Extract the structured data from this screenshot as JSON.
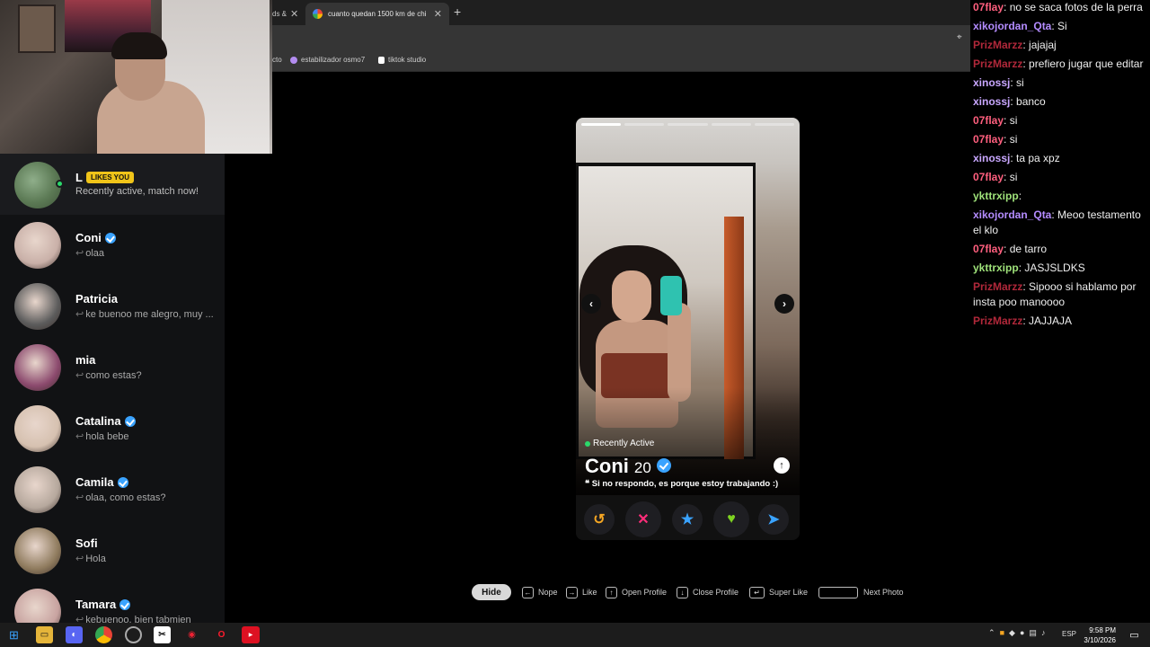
{
  "browser": {
    "tab1_fragment": "ds &",
    "tab2_title": "cuanto quedan 1500 km de chi",
    "close_glyph": "✕",
    "newtab_glyph": "+",
    "bookmarks": [
      {
        "label": "cto"
      },
      {
        "label": "estabilizador osmo7"
      },
      {
        "label": "tiktok studio"
      }
    ]
  },
  "likes": {
    "initial": "L",
    "badge": "LIKES YOU",
    "subtitle": "Recently active, match now!"
  },
  "matches": [
    {
      "name": "Coni",
      "verified": true,
      "msg": "olaa",
      "color": "#c9b0a8"
    },
    {
      "name": "Patricia",
      "verified": false,
      "msg": "ke buenoo me alegro, muy ...",
      "color": "#5c5c5c"
    },
    {
      "name": "mia",
      "verified": false,
      "msg": "como estas?",
      "color": "#8c4a6e"
    },
    {
      "name": "Catalina",
      "verified": true,
      "msg": "hola bebe",
      "color": "#d6c1b0"
    },
    {
      "name": "Camila",
      "verified": true,
      "msg": "olaa, como estas?",
      "color": "#b6a89d"
    },
    {
      "name": "Sofi",
      "verified": false,
      "msg": "Hola",
      "color": "#8f7b5e"
    },
    {
      "name": "Tamara",
      "verified": true,
      "msg": "kebuenoo, bien tabmien",
      "color": "#c8a3a0"
    }
  ],
  "profile": {
    "status": "Recently Active",
    "name": "Coni",
    "age": "20",
    "bio": "❝ Si no respondo, es porque estoy trabajando :)",
    "photo_count": 5,
    "current_photo": 0
  },
  "actions": [
    {
      "name": "rewind",
      "glyph": "↺",
      "color": "#f5a623"
    },
    {
      "name": "nope",
      "glyph": "✕",
      "color": "#ff2d7a"
    },
    {
      "name": "super-like",
      "glyph": "★",
      "color": "#3aa3ff"
    },
    {
      "name": "like",
      "glyph": "♥",
      "color": "#7ed321"
    },
    {
      "name": "boost",
      "glyph": "➤",
      "color": "#3aa3ff"
    }
  ],
  "hints": {
    "hide": "Hide",
    "nope": "Nope",
    "like": "Like",
    "open_profile": "Open Profile",
    "close_profile": "Close Profile",
    "super_like": "Super Like",
    "next_photo": "Next Photo"
  },
  "chat": [
    {
      "user": "07flay",
      "color": "#ff5f7e",
      "text": "no se saca fotos de la perra"
    },
    {
      "user": "xikojordan_Qta",
      "color": "#b48cff",
      "text": "Si"
    },
    {
      "user": "PrizMarzz",
      "color": "#b1283a",
      "text": "jajajaj"
    },
    {
      "user": "PrizMarzz",
      "color": "#b1283a",
      "text": "prefiero jugar que editar"
    },
    {
      "user": "xinossj",
      "color": "#c9a7ff",
      "text": "si"
    },
    {
      "user": "xinossj",
      "color": "#c9a7ff",
      "text": "banco"
    },
    {
      "user": "07flay",
      "color": "#ff5f7e",
      "text": "si"
    },
    {
      "user": "07flay",
      "color": "#ff5f7e",
      "text": "si"
    },
    {
      "user": "xinossj",
      "color": "#c9a7ff",
      "text": "ta pa xpz"
    },
    {
      "user": "07flay",
      "color": "#ff5f7e",
      "text": "si"
    },
    {
      "user": "ykttrxipp",
      "color": "#9fe27a",
      "text": ""
    },
    {
      "user": "xikojordan_Qta",
      "color": "#b48cff",
      "text": "Meoo testamento el klo"
    },
    {
      "user": "07flay",
      "color": "#ff5f7e",
      "text": "de tarro"
    },
    {
      "user": "ykttrxipp",
      "color": "#9fe27a",
      "text": "JASJSLDKS"
    },
    {
      "user": "PrizMarzz",
      "color": "#b1283a",
      "text": "Sipooo si hablamo por insta poo manoooo"
    },
    {
      "user": "PrizMarzz",
      "color": "#b1283a",
      "text": "JAJJAJA"
    }
  ],
  "taskbar": {
    "lang": "ESP",
    "time": "9:58 PM",
    "date": "3/10/2026"
  }
}
